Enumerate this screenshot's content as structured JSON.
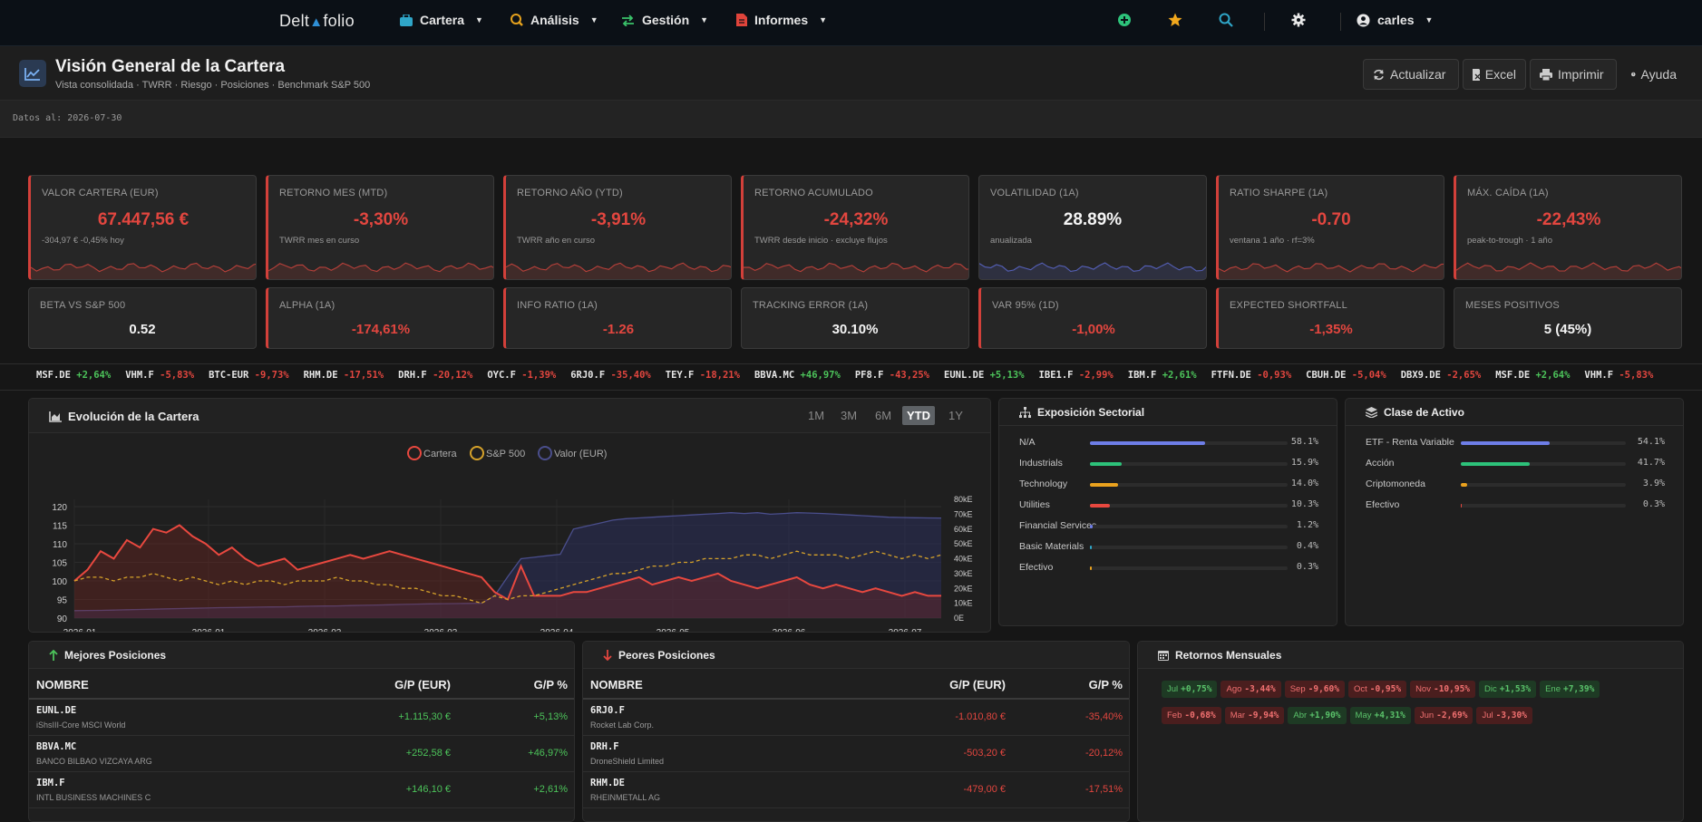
{
  "nav": {
    "brand_pre": "Delt",
    "brand_post": "folio",
    "items": [
      "Cartera",
      "Análisis",
      "Gestión",
      "Informes"
    ],
    "user": "carles",
    "colors": {
      "cartera": "#2fa6c8",
      "analisis": "#e6a21d",
      "gestion": "#3ac26a",
      "informes": "#e0443b"
    }
  },
  "header": {
    "title": "Visión General de la Cartera",
    "subtitle": "Vista consolidada · TWRR · Riesgo · Posiciones · Benchmark S&P 500",
    "buttons": {
      "refresh": "Actualizar",
      "excel": "Excel",
      "print": "Imprimir",
      "help": "Ayuda"
    }
  },
  "date_label": "Datos al: 2026-07-30",
  "kpis_row1": [
    {
      "label": "VALOR CARTERA (EUR)",
      "value": "67.447,56 €",
      "note": "-304,97 € -0,45% hoy",
      "tone": "neg"
    },
    {
      "label": "RETORNO MES (MTD)",
      "value": "-3,30%",
      "note": "TWRR mes en curso",
      "tone": "neg"
    },
    {
      "label": "RETORNO AÑO (YTD)",
      "value": "-3,91%",
      "note": "TWRR año en curso",
      "tone": "neg"
    },
    {
      "label": "RETORNO ACUMULADO",
      "value": "-24,32%",
      "note": "TWRR desde inicio · excluye flujos",
      "tone": "neg"
    },
    {
      "label": "VOLATILIDAD (1A)",
      "value": "28.89%",
      "note": "anualizada",
      "tone": "wht"
    },
    {
      "label": "RATIO SHARPE (1A)",
      "value": "-0.70",
      "note": "ventana 1 año · rf=3%",
      "tone": "neg"
    },
    {
      "label": "MÁX. CAÍDA (1A)",
      "value": "-22,43%",
      "note": "peak-to-trough · 1 año",
      "tone": "neg"
    }
  ],
  "kpis_row2": [
    {
      "label": "BETA VS S&P 500",
      "value": "0.52",
      "tone": "wht"
    },
    {
      "label": "ALPHA (1A)",
      "value": "-174,61%",
      "tone": "neg"
    },
    {
      "label": "INFO RATIO (1A)",
      "value": "-1.26",
      "tone": "neg"
    },
    {
      "label": "TRACKING ERROR (1A)",
      "value": "30.10%",
      "tone": "wht"
    },
    {
      "label": "VAR 95% (1D)",
      "value": "-1,00%",
      "tone": "neg"
    },
    {
      "label": "EXPECTED SHORTFALL",
      "value": "-1,35%",
      "tone": "neg"
    },
    {
      "label": "MESES POSITIVOS",
      "value": "5 (45%)",
      "tone": "wht"
    }
  ],
  "ticker": [
    {
      "sym": "MSF.DE",
      "chg": "+2,64%"
    },
    {
      "sym": "VHM.F",
      "chg": "-5,83%"
    },
    {
      "sym": "BTC-EUR",
      "chg": "-9,73%"
    },
    {
      "sym": "RHM.DE",
      "chg": "-17,51%"
    },
    {
      "sym": "DRH.F",
      "chg": "-20,12%"
    },
    {
      "sym": "OYC.F",
      "chg": "-1,39%"
    },
    {
      "sym": "6RJ0.F",
      "chg": "-35,40%"
    },
    {
      "sym": "TEY.F",
      "chg": "-18,21%"
    },
    {
      "sym": "BBVA.MC",
      "chg": "+46,97%"
    },
    {
      "sym": "PF8.F",
      "chg": "-43,25%"
    },
    {
      "sym": "EUNL.DE",
      "chg": "+5,13%"
    },
    {
      "sym": "IBE1.F",
      "chg": "-2,99%"
    },
    {
      "sym": "IBM.F",
      "chg": "+2,61%"
    },
    {
      "sym": "FTFN.DE",
      "chg": "-0,93%"
    },
    {
      "sym": "CBUH.DE",
      "chg": "-5,04%"
    },
    {
      "sym": "DBX9.DE",
      "chg": "-2,65%"
    },
    {
      "sym": "MSF.DE",
      "chg": "+2,64%"
    },
    {
      "sym": "VHM.F",
      "chg": "-5,83%"
    }
  ],
  "evolution": {
    "title": "Evolución de la Cartera",
    "ranges": [
      "1M",
      "3M",
      "6M",
      "YTD",
      "1Y"
    ],
    "active_range": "YTD"
  },
  "chart_data": {
    "type": "line",
    "legend": [
      "Cartera",
      "S&P 500",
      "Valor (EUR)"
    ],
    "x_ticks": [
      "2026-01",
      "2026-01",
      "2026-02",
      "2026-03",
      "2026-04",
      "2026-05",
      "2026-06",
      "2026-07"
    ],
    "y_left": {
      "min": 90,
      "max": 120,
      "ticks": [
        "120",
        "115",
        "110",
        "105",
        "100",
        "95",
        "90"
      ]
    },
    "y_right": {
      "min": 0,
      "max": 80000,
      "ticks": [
        "80kE",
        "70kE",
        "60kE",
        "50kE",
        "40kE",
        "30kE",
        "20kE",
        "10kE",
        "0E"
      ]
    },
    "series": [
      {
        "name": "Cartera",
        "color": "#e8483f",
        "values": [
          100,
          103,
          108,
          106,
          111,
          109,
          114,
          113,
          115,
          112,
          110,
          107,
          109,
          106,
          104,
          105,
          106,
          103,
          104,
          105,
          106,
          107,
          106,
          107,
          108,
          107,
          106,
          105,
          104,
          103,
          102,
          101,
          97,
          95,
          104,
          96,
          96,
          96,
          97,
          97,
          98,
          99,
          100,
          101,
          99,
          100,
          101,
          100,
          101,
          102,
          100,
          99,
          98,
          99,
          100,
          101,
          99,
          98,
          99,
          98,
          97,
          98,
          97,
          96,
          97,
          96,
          96
        ]
      },
      {
        "name": "S&P 500",
        "color": "#d6a22a",
        "values": [
          100,
          101,
          101,
          100,
          101,
          101,
          102,
          101,
          100,
          101,
          100,
          99,
          100,
          99,
          100,
          100,
          99,
          100,
          100,
          100,
          101,
          100,
          100,
          99,
          99,
          98,
          98,
          97,
          96,
          96,
          95,
          94,
          96,
          95,
          96,
          96,
          97,
          98,
          99,
          100,
          101,
          102,
          102,
          103,
          104,
          104,
          105,
          105,
          106,
          106,
          106,
          107,
          107,
          106,
          107,
          108,
          107,
          107,
          107,
          106,
          107,
          108,
          107,
          106,
          107,
          106,
          107
        ]
      },
      {
        "name": "Valor (EUR)",
        "color": "#4a4e8c",
        "values": [
          5000,
          5100,
          5200,
          5400,
          5600,
          5800,
          6000,
          6200,
          6400,
          6600,
          6800,
          7000,
          7100,
          7200,
          7400,
          7500,
          7600,
          7800,
          8000,
          8100,
          8200,
          8400,
          8600,
          8800,
          9000,
          9200,
          9400,
          9600,
          9700,
          9800,
          9900,
          10000,
          15000,
          28000,
          40000,
          41000,
          42000,
          43000,
          60000,
          62000,
          64000,
          66000,
          67000,
          67500,
          68000,
          68500,
          69000,
          69500,
          70000,
          70500,
          71000,
          70500,
          71000,
          70000,
          70500,
          71000,
          70800,
          70500,
          70000,
          69500,
          69000,
          68500,
          68000,
          67800,
          67600,
          67500,
          67447
        ]
      }
    ]
  },
  "sector": {
    "title": "Exposición Sectorial",
    "items": [
      {
        "name": "N/A",
        "pct": "58.1%",
        "value": 58.1,
        "color": "#6e7ee8"
      },
      {
        "name": "Industrials",
        "pct": "15.9%",
        "value": 15.9,
        "color": "#2dc27a"
      },
      {
        "name": "Technology",
        "pct": "14.0%",
        "value": 14.0,
        "color": "#eaa21e"
      },
      {
        "name": "Utilities",
        "pct": "10.3%",
        "value": 10.3,
        "color": "#e8483f"
      },
      {
        "name": "Financial Services",
        "pct": "1.2%",
        "value": 1.2,
        "color": "#6e7ee8"
      },
      {
        "name": "Basic Materials",
        "pct": "0.4%",
        "value": 0.4,
        "color": "#2fa6c8"
      },
      {
        "name": "Efectivo",
        "pct": "0.3%",
        "value": 0.3,
        "color": "#eaa21e"
      }
    ]
  },
  "asset_class": {
    "title": "Clase de Activo",
    "items": [
      {
        "name": "ETF - Renta Variable",
        "pct": "54.1%",
        "value": 54.1,
        "color": "#6e7ee8"
      },
      {
        "name": "Acción",
        "pct": "41.7%",
        "value": 41.7,
        "color": "#2dc27a"
      },
      {
        "name": "Criptomoneda",
        "pct": "3.9%",
        "value": 3.9,
        "color": "#eaa21e"
      },
      {
        "name": "Efectivo",
        "pct": "0.3%",
        "value": 0.3,
        "color": "#e8483f"
      }
    ]
  },
  "best": {
    "title": "Mejores Posiciones",
    "headers": [
      "NOMBRE",
      "G/P (EUR)",
      "G/P %"
    ],
    "rows": [
      {
        "ticker": "EUNL.DE",
        "name": "iShsIII-Core MSCI World",
        "pl": "+1.115,30 €",
        "pct": "+5,13%"
      },
      {
        "ticker": "BBVA.MC",
        "name": "BANCO BILBAO VIZCAYA ARG",
        "pl": "+252,58 €",
        "pct": "+46,97%"
      },
      {
        "ticker": "IBM.F",
        "name": "INTL BUSINESS MACHINES C",
        "pl": "+146,10 €",
        "pct": "+2,61%"
      }
    ]
  },
  "worst": {
    "title": "Peores Posiciones",
    "headers": [
      "NOMBRE",
      "G/P (EUR)",
      "G/P %"
    ],
    "rows": [
      {
        "ticker": "6RJ0.F",
        "name": "Rocket Lab Corp.",
        "pl": "-1.010,80 €",
        "pct": "-35,40%"
      },
      {
        "ticker": "DRH.F",
        "name": "DroneShield Limited",
        "pl": "-503,20 €",
        "pct": "-20,12%"
      },
      {
        "ticker": "RHM.DE",
        "name": "RHEINMETALL AG",
        "pl": "-479,00 €",
        "pct": "-17,51%"
      }
    ]
  },
  "monthly": {
    "title": "Retornos Mensuales",
    "rows": [
      [
        {
          "m": "Jul",
          "v": "+0,75%",
          "t": "p"
        },
        {
          "m": "Ago",
          "v": "-3,44%",
          "t": "n"
        },
        {
          "m": "Sep",
          "v": "-9,60%",
          "t": "n"
        },
        {
          "m": "Oct",
          "v": "-0,95%",
          "t": "n"
        },
        {
          "m": "Nov",
          "v": "-10,95%",
          "t": "n"
        },
        {
          "m": "Dic",
          "v": "+1,53%",
          "t": "p"
        },
        {
          "m": "Ene",
          "v": "+7,39%",
          "t": "p"
        }
      ],
      [
        {
          "m": "Feb",
          "v": "-0,68%",
          "t": "n"
        },
        {
          "m": "Mar",
          "v": "-9,94%",
          "t": "n"
        },
        {
          "m": "Abr",
          "v": "+1,90%",
          "t": "p"
        },
        {
          "m": "May",
          "v": "+4,31%",
          "t": "p"
        },
        {
          "m": "Jun",
          "v": "-2,69%",
          "t": "n"
        },
        {
          "m": "Jul",
          "v": "-3,30%",
          "t": "n"
        }
      ]
    ]
  }
}
